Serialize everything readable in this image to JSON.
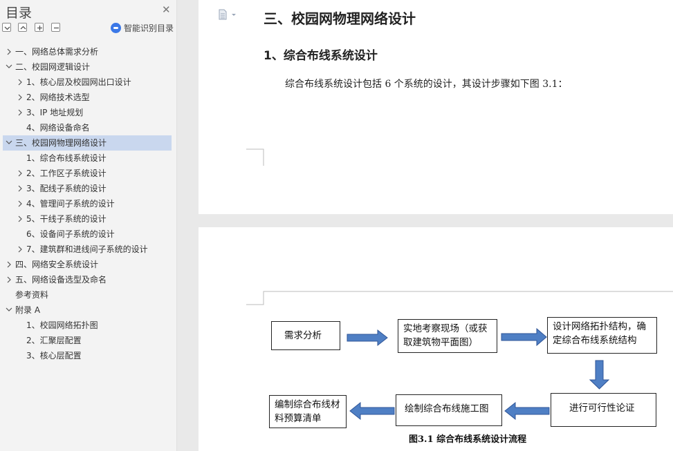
{
  "toc": {
    "title": "目录",
    "ai_toc_label": "智能识别目录",
    "items": [
      {
        "label": "一、网络总体需求分析",
        "level": 0,
        "expander": "right"
      },
      {
        "label": "二、校园网逻辑设计",
        "level": 0,
        "expander": "down"
      },
      {
        "label": "1、核心层及校园网出口设计",
        "level": 1,
        "expander": "right"
      },
      {
        "label": "2、网络技术选型",
        "level": 1,
        "expander": "right"
      },
      {
        "label": "3、IP 地址规划",
        "level": 1,
        "expander": "right"
      },
      {
        "label": "4、网络设备命名",
        "level": 1,
        "expander": "none"
      },
      {
        "label": "三、校园网物理网络设计",
        "level": 0,
        "expander": "down",
        "active": true
      },
      {
        "label": "1、综合布线系统设计",
        "level": 1,
        "expander": "none"
      },
      {
        "label": "2、工作区子系统设计",
        "level": 1,
        "expander": "right"
      },
      {
        "label": "3、配线子系统的设计",
        "level": 1,
        "expander": "right"
      },
      {
        "label": "4、管理间子系统的设计",
        "level": 1,
        "expander": "right"
      },
      {
        "label": "5、干线子系统的设计",
        "level": 1,
        "expander": "right"
      },
      {
        "label": "6、设备间子系统的设计",
        "level": 1,
        "expander": "none"
      },
      {
        "label": "7、建筑群和进线间子系统的设计",
        "level": 1,
        "expander": "right"
      },
      {
        "label": "四、网络安全系统设计",
        "level": 0,
        "expander": "right"
      },
      {
        "label": "五、网络设备选型及命名",
        "level": 0,
        "expander": "right"
      },
      {
        "label": "参考资料",
        "level": 0,
        "expander": "none"
      },
      {
        "label": "附录 A",
        "level": 0,
        "expander": "down"
      },
      {
        "label": "1、校园网络拓扑图",
        "level": 1,
        "expander": "none"
      },
      {
        "label": "2、汇聚层配置",
        "level": 1,
        "expander": "none"
      },
      {
        "label": "3、核心层配置",
        "level": 1,
        "expander": "none"
      }
    ]
  },
  "document": {
    "heading1": "三、校园网物理网络设计",
    "heading2": "1、综合布线系统设计",
    "paragraph": "综合布线系统设计包括 6 个系统的设计，其设计步骤如下图 3.1：",
    "flowchart": {
      "box1": "需求分析",
      "box2": "实地考察现场（或获取建筑物平面图）",
      "box3": "设计网络拓扑结构，确定综合布线系统结构",
      "box4": "进行可行性论证",
      "box5": "绘制综合布线施工图",
      "box6": "编制综合布线材料预算清单"
    },
    "caption": "图3.1  综合布线系统设计流程"
  },
  "colors": {
    "active_row": "#c9d7ee",
    "arrow_fill": "#4f7fc4",
    "arrow_stroke": "#2f5597"
  },
  "icons": [
    "close-icon",
    "collapse-all-icon",
    "expand-all-icon",
    "plus-icon",
    "minus-icon",
    "ai-toc-icon",
    "document-icon",
    "chevron-right-icon",
    "chevron-down-icon"
  ]
}
